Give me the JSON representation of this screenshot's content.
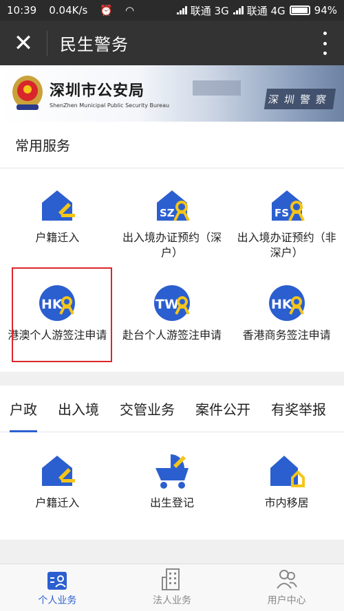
{
  "status_bar": {
    "time": "10:39",
    "speed": "0.04K/s",
    "carrier1": "联通 3G",
    "carrier2": "联通 4G",
    "battery": "94%"
  },
  "title_bar": {
    "title": "民生警务"
  },
  "banner": {
    "cn": "深圳市公安局",
    "en": "ShenZhen Municipal Public Security Bureau",
    "sign": "深圳警察"
  },
  "common_services": {
    "header": "常用服务",
    "items": [
      {
        "label": "户籍迁入",
        "icon": "house-arrow-icon"
      },
      {
        "label": "出入境办证预约（深户）",
        "icon": "sz-house-person-icon"
      },
      {
        "label": "出入境办证预约（非深户）",
        "icon": "fs-house-person-icon"
      },
      {
        "label": "港澳个人游签注申请",
        "icon": "hk-circle-person-icon"
      },
      {
        "label": "赴台个人游签注申请",
        "icon": "tw-circle-person-icon"
      },
      {
        "label": "香港商务签注申请",
        "icon": "hk-circle-person-icon"
      }
    ],
    "icon_text": {
      "sz": "SZ",
      "fs": "FS",
      "hk": "HK",
      "tw": "TW"
    }
  },
  "tabs": [
    "户政",
    "出入境",
    "交管业务",
    "案件公开",
    "有奖举报"
  ],
  "tab_items": [
    {
      "label": "户籍迁入",
      "icon": "house-arrow-icon"
    },
    {
      "label": "出生登记",
      "icon": "stroller-icon"
    },
    {
      "label": "市内移居",
      "icon": "house-move-icon"
    }
  ],
  "bottom_nav": [
    {
      "label": "个人业务",
      "icon": "person-card-icon"
    },
    {
      "label": "法人业务",
      "icon": "building-icon"
    },
    {
      "label": "用户中心",
      "icon": "users-icon"
    }
  ],
  "colors": {
    "primary": "#2b5fcf",
    "accent_yellow": "#f5c518",
    "highlight": "#d9262b"
  }
}
